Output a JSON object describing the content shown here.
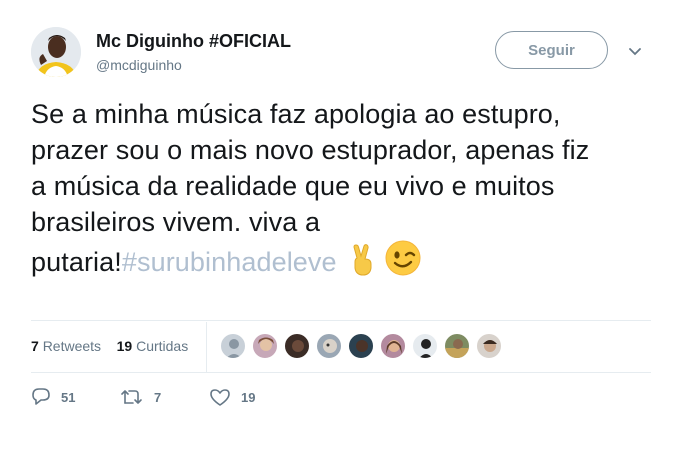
{
  "user": {
    "display_name": "Mc Diguinho #OFICIAL",
    "handle": "@mcdiguinho"
  },
  "follow_button": {
    "label": "Seguir"
  },
  "tweet": {
    "lines": [
      "Se a minha música faz apologia ao estupro,",
      "prazer sou o mais novo estuprador, apenas fiz",
      "a música da realidade que eu vivo e muitos",
      "brasileiros vivem. viva a"
    ],
    "last_line_text": "putaria!",
    "hashtag": "#surubinhadeleve",
    "emojis": [
      "victory-hand-emoji",
      "winking-face-emoji"
    ]
  },
  "stats": {
    "retweets_count": "7",
    "retweets_label": "Retweets",
    "likes_count": "19",
    "likes_label": "Curtidas"
  },
  "actions": {
    "replies": "51",
    "retweets": "7",
    "likes": "19"
  },
  "colors": {
    "text": "#14171a",
    "secondary": "#657786",
    "hashtag": "#b0bfd0",
    "border": "#e6ecf0"
  }
}
